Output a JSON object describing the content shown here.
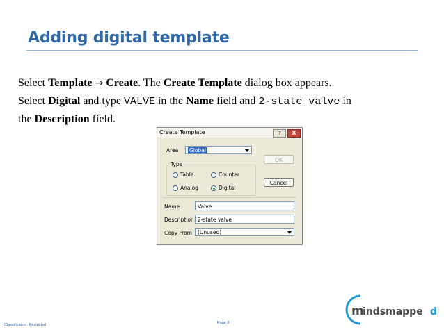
{
  "slide": {
    "title": "Adding digital template",
    "line1": {
      "p1": "Select ",
      "b1": "Template",
      "arrow": "→",
      "b2": "Create",
      "p2": ". The ",
      "b3": "Create Template",
      "p3": " dialog box appears."
    },
    "line2": {
      "p1": "Select ",
      "b1": "Digital",
      "p2": " and type ",
      "code1": "VALVE",
      "p3": " in the ",
      "b2": "Name",
      "p4": " field and ",
      "code2": "2-state valve",
      "p5": " in"
    },
    "line3": {
      "p1": "the ",
      "b1": "Description",
      "p2": " field."
    }
  },
  "dialog": {
    "title": "Create Template",
    "help_label": "?",
    "close_label": "X",
    "area_label": "Area",
    "area_value": "Global",
    "type_label": "Type",
    "radios": [
      {
        "label": "Table",
        "selected": false
      },
      {
        "label": "Counter",
        "selected": false
      },
      {
        "label": "Analog",
        "selected": false
      },
      {
        "label": "Digital",
        "selected": true
      }
    ],
    "ok_label": "OK",
    "cancel_label": "Cancel",
    "name_label": "Name",
    "name_value": "Valve",
    "description_label": "Description",
    "description_value": "2-state valve",
    "copy_from_label": "Copy From",
    "copy_from_value": "(Unused)"
  },
  "footer": {
    "classification": "Classification: Restricted",
    "page": "Page 8"
  },
  "logo": {
    "text_m": "m",
    "text_rest": "indsmappe",
    "text_d": "d",
    "accent_color": "#1d9ad6",
    "text_color": "#4a4a4a"
  }
}
